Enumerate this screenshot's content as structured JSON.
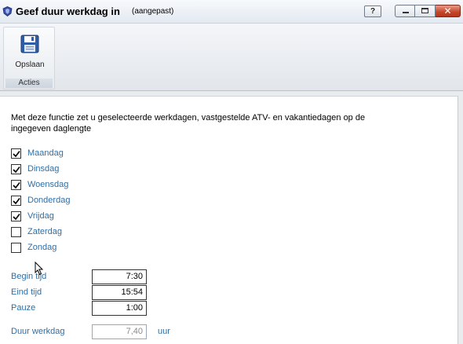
{
  "window": {
    "title": "Geef duur werkdag in",
    "subtitle": "(aangepast)",
    "help_label": "?",
    "close_label": "✕"
  },
  "ribbon": {
    "save_label": "Opslaan",
    "group_label": "Acties"
  },
  "form": {
    "intro": "Met deze functie zet u geselecteerde werkdagen, vastgestelde ATV- en vakantiedagen op de ingegeven daglengte",
    "days": [
      {
        "label": "Maandag",
        "checked": true
      },
      {
        "label": "Dinsdag",
        "checked": true
      },
      {
        "label": "Woensdag",
        "checked": true
      },
      {
        "label": "Donderdag",
        "checked": true
      },
      {
        "label": "Vrijdag",
        "checked": true
      },
      {
        "label": "Zaterdag",
        "checked": false
      },
      {
        "label": "Zondag",
        "checked": false
      }
    ],
    "begin_label": "Begin tijd",
    "begin_value": "7:30",
    "end_label": "Eind tijd",
    "end_value": "15:54",
    "pause_label": "Pauze",
    "pause_value": "1:00",
    "duration_label": "Duur werkdag",
    "duration_value": "7,40",
    "duration_unit": "uur"
  }
}
